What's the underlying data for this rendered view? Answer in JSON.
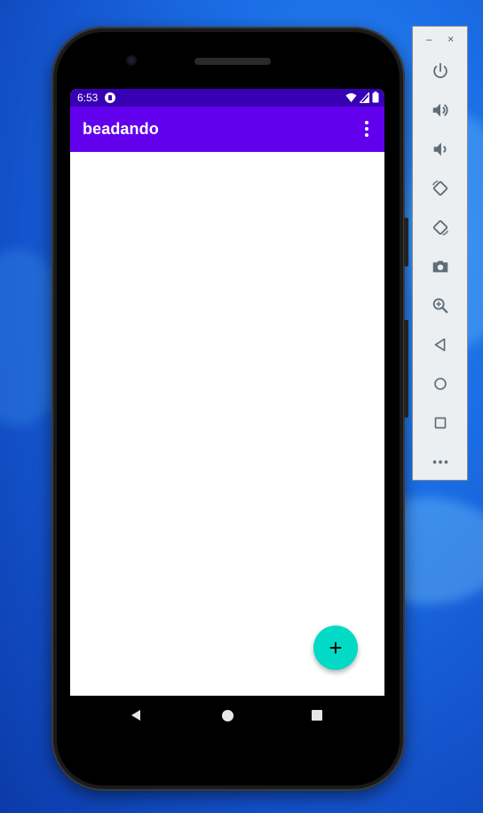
{
  "status_bar": {
    "time": "6:53"
  },
  "app_bar": {
    "title": "beadando"
  },
  "fab": {
    "label": "+"
  },
  "emulator_toolbar": {
    "minimize_label": "–",
    "close_label": "×",
    "items": [
      {
        "icon": "power-icon"
      },
      {
        "icon": "volume-up-icon"
      },
      {
        "icon": "volume-down-icon"
      },
      {
        "icon": "rotate-left-icon"
      },
      {
        "icon": "rotate-right-icon"
      },
      {
        "icon": "camera-icon"
      },
      {
        "icon": "zoom-icon"
      },
      {
        "icon": "back-icon"
      },
      {
        "icon": "home-icon"
      },
      {
        "icon": "overview-icon"
      },
      {
        "icon": "more-icon"
      }
    ]
  },
  "colors": {
    "status_bar": "#3700b3",
    "app_bar": "#6200ee",
    "fab": "#03dac5",
    "toolbar_icon": "#5f6d78"
  }
}
